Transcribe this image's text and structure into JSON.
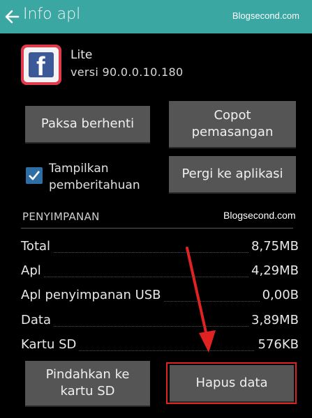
{
  "appbar": {
    "title": "Info apl",
    "watermark": "Blogsecond.com"
  },
  "app": {
    "name": "Lite",
    "version": "versi 90.0.0.10.180"
  },
  "buttons": {
    "force_stop": "Paksa berhenti",
    "uninstall_line1": "Copot",
    "uninstall_line2": "pemasangan",
    "go_to_app": "Pergi ke aplikasi",
    "move_line1": "Pindahkan ke",
    "move_line2": "kartu SD",
    "clear_data": "Hapus data"
  },
  "notifications": {
    "line1": "Tampilkan",
    "line2": "pemberitahuan",
    "checked": true
  },
  "storage": {
    "title": "PENYIMPANAN",
    "watermark": "Blogsecond.com",
    "rows": [
      {
        "label": "Total",
        "value": "8,75MB"
      },
      {
        "label": "Apl",
        "value": "4,29MB"
      },
      {
        "label": "Apl penyimpanan USB",
        "value": "0,00B"
      },
      {
        "label": "Data",
        "value": "3,89MB"
      },
      {
        "label": "Kartu SD",
        "value": "576KB"
      }
    ]
  },
  "colors": {
    "appbar": "#3aa7a2",
    "button": "#555555",
    "checkbox": "#2d6fa4",
    "annotation": "#e12222",
    "facebook": "#3b5998"
  }
}
